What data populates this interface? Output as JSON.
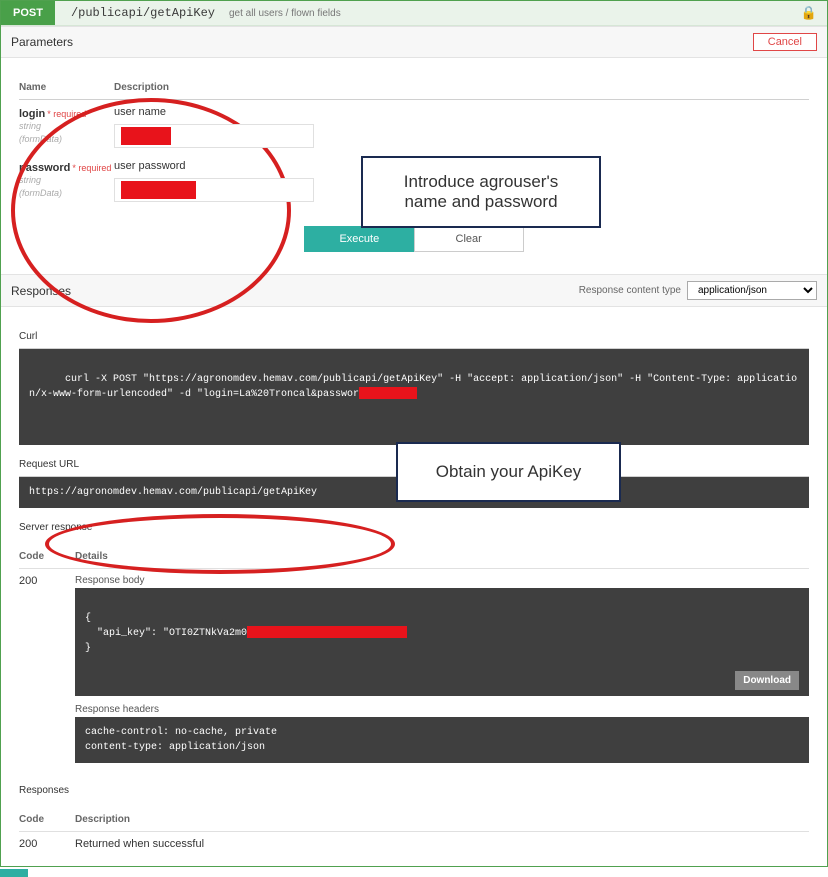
{
  "method": "POST",
  "path": "/publicapi/getApiKey",
  "method_desc": "get all users / flown fields",
  "parameters_title": "Parameters",
  "cancel": "Cancel",
  "headers": {
    "name": "Name",
    "description": "Description"
  },
  "required_label": "* required",
  "params": [
    {
      "name": "login",
      "type": "string",
      "in": "(formData)",
      "desc": "user name"
    },
    {
      "name": "password",
      "type": "string",
      "in": "(formData)",
      "desc": "user password"
    }
  ],
  "callout1": "Introduce agrouser's\nname and password",
  "callout2": "Obtain your ApiKey",
  "execute": "Execute",
  "clear": "Clear",
  "responses_title": "Responses",
  "content_type_label": "Response content type",
  "content_type": "application/json",
  "curl_label": "Curl",
  "curl_cmd": "curl -X POST \"https://agronomdev.hemav.com/publicapi/getApiKey\" -H \"accept: application/json\" -H \"Content-Type: application/x-www-form-urlencoded\" -d \"login=La%20Troncal&passwor",
  "request_url_label": "Request URL",
  "request_url": "https://agronomdev.hemav.com/publicapi/getApiKey",
  "server_resp_label": "Server response",
  "code_hdr": "Code",
  "details_hdr": "Details",
  "server_code": "200",
  "resp_body_label": "Response body",
  "resp_body_pre": "{\n  \"api_key\": \"OTI0ZTNkVa2m0",
  "resp_body_post": "\n}",
  "download": "Download",
  "resp_headers_label": "Response headers",
  "resp_headers": "cache-control: no-cache, private\ncontent-type: application/json",
  "responses_tbl_label": "Responses",
  "desc_hdr": "Description",
  "r200_code": "200",
  "r200_desc": "Returned when successful"
}
